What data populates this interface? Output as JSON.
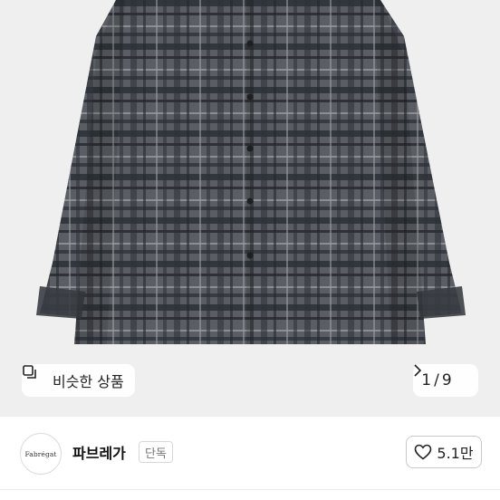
{
  "product": {
    "image_alt": "gray plaid long-sleeve shirt",
    "similar_label": "비슷한 상품",
    "pager": {
      "current": "1",
      "separator": "/",
      "total": "9"
    }
  },
  "seller": {
    "logo_text": "Fabrégat",
    "name": "파브레가",
    "badge": "단독",
    "like_count": "5.1만"
  },
  "colors": {
    "shirt": "#4f5358",
    "check": "#2a2d33",
    "stripe": "#8d9096"
  },
  "icons": {
    "similar": "similar-items-icon",
    "next": "chevron-right-icon",
    "like": "heart-outline-icon"
  }
}
